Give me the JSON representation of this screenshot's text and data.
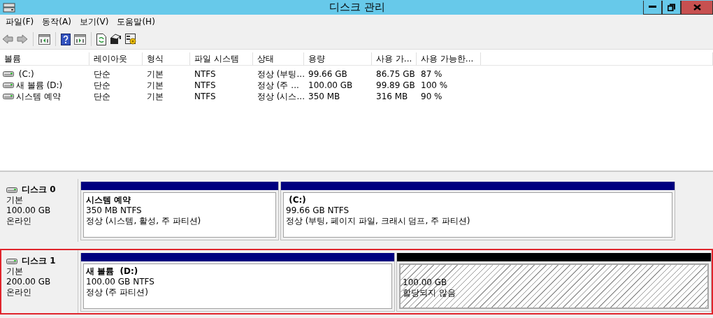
{
  "window": {
    "title": "디스크 관리"
  },
  "menu": [
    "파일(F)",
    "동작(A)",
    "보기(V)",
    "도움말(H)"
  ],
  "volume_list": {
    "columns": [
      "볼륨",
      "레이아웃",
      "형식",
      "파일 시스템",
      "상태",
      "용량",
      "사용 가...",
      "사용 가능한..."
    ],
    "rows": [
      {
        "volume": " (C:)",
        "layout": "단순",
        "type": "기본",
        "file_system": "NTFS",
        "status": "정상 (부팅...",
        "capacity": "99.66 GB",
        "free": "86.75 GB",
        "free_percent": "87 %"
      },
      {
        "volume": "새 볼륨 (D:)",
        "layout": "단순",
        "type": "기본",
        "file_system": "NTFS",
        "status": "정상 (주 ...",
        "capacity": "100.00 GB",
        "free": "99.89 GB",
        "free_percent": "100 %"
      },
      {
        "volume": "시스템 예약",
        "layout": "단순",
        "type": "기본",
        "file_system": "NTFS",
        "status": "정상 (시스...",
        "capacity": "350 MB",
        "free": "316 MB",
        "free_percent": "90 %"
      }
    ]
  },
  "disks": [
    {
      "name": "디스크 0",
      "type": "기본",
      "size": "100.00 GB",
      "state": "온라인",
      "selected": false,
      "partitions": [
        {
          "kind": "primary",
          "name": "시스템 예약",
          "size": "350 MB NTFS",
          "status": "정상 (시스템, 활성, 주 파티션)"
        },
        {
          "kind": "primary",
          "name": " (C:)",
          "size": "99.66 GB NTFS",
          "status": "정상 (부팅, 페이지 파일, 크래시 덤프, 주 파티션)"
        }
      ]
    },
    {
      "name": "디스크 1",
      "type": "기본",
      "size": "200.00 GB",
      "state": "온라인",
      "selected": true,
      "partitions": [
        {
          "kind": "primary",
          "name": "새 볼륨  (D:)",
          "size": "100.00 GB NTFS",
          "status": "정상 (주 파티션)"
        },
        {
          "kind": "unallocated",
          "size": "100.00 GB",
          "status": "할당되지 않음"
        }
      ]
    }
  ]
}
